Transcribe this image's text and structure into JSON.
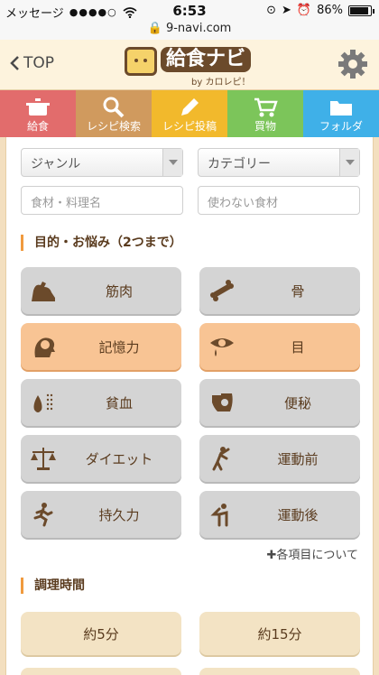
{
  "status": {
    "carrier": "メッセージ",
    "signal": "●●●●○",
    "time": "6:53",
    "battery": "86%"
  },
  "url": "9-navi.com",
  "header": {
    "back_label": "TOP",
    "logo_title": "給食ナビ",
    "logo_sub": "by カロレピ！"
  },
  "nav": [
    {
      "label": "給食",
      "color": "#e26c6c",
      "icon": "pot-icon"
    },
    {
      "label": "レシピ検索",
      "color": "#d09a5e",
      "icon": "search-icon"
    },
    {
      "label": "レシピ投稿",
      "color": "#f2b92c",
      "icon": "pencil-icon"
    },
    {
      "label": "買物",
      "color": "#7cc55a",
      "icon": "cart-icon"
    },
    {
      "label": "フォルダ",
      "color": "#3fb0e8",
      "icon": "folder-icon"
    }
  ],
  "search": {
    "genre": "ジャンル",
    "category": "カテゴリー",
    "ingredient_placeholder": "食材・料理名",
    "exclude_placeholder": "使わない食材"
  },
  "purpose": {
    "title": "目的・お悩み（2つまで）",
    "items": [
      {
        "label": "筋肉",
        "icon": "muscle-icon",
        "active": false
      },
      {
        "label": "骨",
        "icon": "bone-icon",
        "active": false
      },
      {
        "label": "記憶力",
        "icon": "brain-icon",
        "active": true
      },
      {
        "label": "目",
        "icon": "eye-icon",
        "active": true
      },
      {
        "label": "貧血",
        "icon": "blood-drop-icon",
        "active": false
      },
      {
        "label": "便秘",
        "icon": "stomach-icon",
        "active": false
      },
      {
        "label": "ダイエット",
        "icon": "scale-icon",
        "active": false
      },
      {
        "label": "運動前",
        "icon": "stretch-icon",
        "active": false
      },
      {
        "label": "持久力",
        "icon": "runner-icon",
        "active": false
      },
      {
        "label": "運動後",
        "icon": "cooldown-icon",
        "active": false
      }
    ],
    "about_label": "各項目について"
  },
  "cooking_time": {
    "title": "調理時間",
    "options": [
      "約5分",
      "約15分"
    ]
  }
}
